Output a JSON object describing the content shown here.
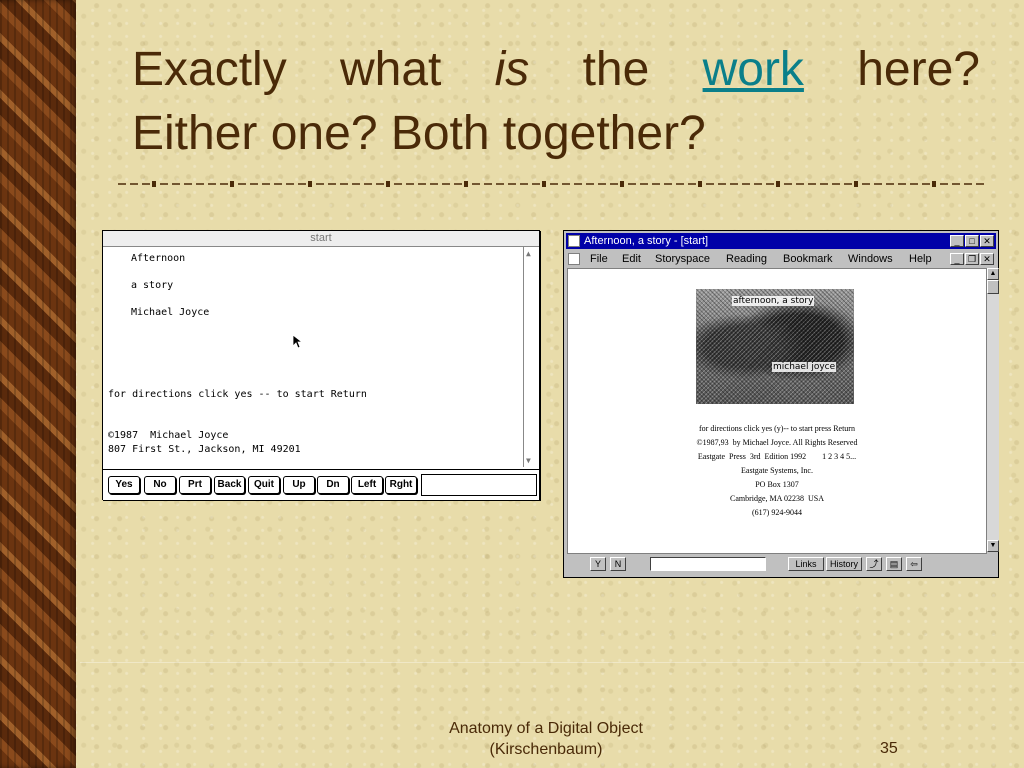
{
  "slide": {
    "title_line1": [
      "Exactly",
      "what",
      "is",
      "the",
      "work",
      "here?"
    ],
    "title_line2": "Either one? Both together?",
    "footer_title_line1": "Anatomy of a Digital Object",
    "footer_title_line2": "(Kirschenbaum)",
    "page_number": "35",
    "colors": {
      "title": "#4a2a08",
      "link": "#0a7f8a",
      "background": "#e8dcaa"
    }
  },
  "mac_window": {
    "title": "start",
    "lines": [
      "Afternoon",
      "a story",
      "Michael Joyce",
      "for directions click yes -- to start Return",
      "©1987  Michael Joyce",
      "807 First St., Jackson, MI 49201"
    ],
    "buttons": [
      "Yes",
      "No",
      "Prt",
      "Back",
      "Quit",
      "Up",
      "Dn",
      "Left",
      "Rght"
    ],
    "input_value": ""
  },
  "win_window": {
    "title": "Afternoon, a story - [start]",
    "menu": [
      "File",
      "Edit",
      "Storyspace",
      "Reading",
      "Bookmark",
      "Windows",
      "Help"
    ],
    "image_labels": [
      "afternoon, a story",
      "michael joyce"
    ],
    "lines": [
      "for directions click yes (y)-- to start press Return",
      "©1987,93  by Michael Joyce. All Rights Reserved",
      "Eastgate  Press  3rd  Edition 1992        1 2 3 4 5...",
      "Eastgate Systems, Inc.",
      "PO Box 1307",
      "Cambridge, MA 02238  USA",
      "(617) 924-9044"
    ],
    "bottom_buttons": [
      "Y",
      "N",
      "Links",
      "History"
    ],
    "input_value": ""
  }
}
